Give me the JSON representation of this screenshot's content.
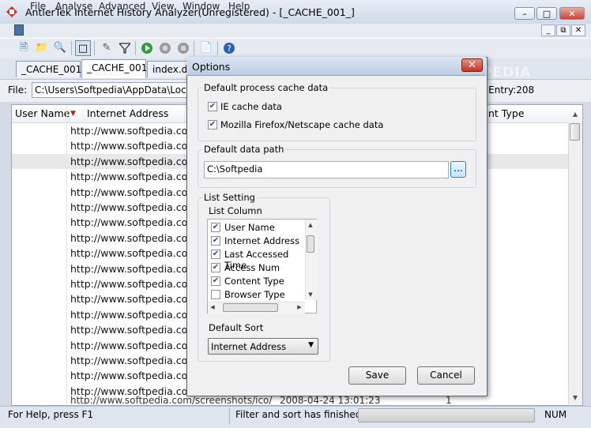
{
  "window": {
    "title": "AntlerTek Internet History Analyzer(Unregistered) - [_CACHE_001_]"
  },
  "menu": [
    "File",
    "Analyse",
    "Advanced",
    "View",
    "Window",
    "Help"
  ],
  "tabs": [
    "_CACHE_001_",
    "_CACHE_001_",
    "index.dat"
  ],
  "filebar": {
    "label": "File:",
    "path": "C:\\Users\\Softpedia\\AppData\\Local\\Temp",
    "entry": "l Entry:208"
  },
  "columns": {
    "user": "User Name",
    "url": "Internet Address",
    "type": "nt Type"
  },
  "rows": [
    "http://www.softpedia.com/",
    "http://www.softpedia.com/",
    "http://www.softpedia.com/",
    "http://www.softpedia.com/",
    "http://www.softpedia.com/",
    "http://www.softpedia.com/",
    "http://www.softpedia.com/",
    "http://www.softpedia.com/",
    "http://www.softpedia.com/",
    "http://www.softpedia.com/",
    "http://www.softpedia.com/",
    "http://www.softpedia.com/",
    "http://www.softpedia.com/",
    "http://www.softpedia.com/",
    "http://www.softpedia.com/",
    "http://www.softpedia.com/",
    "http://www.softpedia.com/",
    "http://www.softpedia.com/"
  ],
  "partial_row": {
    "url": "http://www.softpedia.com/screenshots/ico/",
    "date": "2008-04-24  13:01:23",
    "num": "1"
  },
  "status": {
    "help": "For Help, press F1",
    "message": "Filter and sort has finished!",
    "num": "NUM"
  },
  "watermark": "SOFTPEDIA",
  "dialog": {
    "title": "Options",
    "process_group": "Default process cache data",
    "ie": "IE cache data",
    "ff": "Mozilla Firefox/Netscape cache data",
    "path_group": "Default data path",
    "path_value": "C:\\Softpedia",
    "browse": "...",
    "list_group": "List Setting",
    "list_column": "List Column",
    "columns": [
      {
        "label": "User Name",
        "checked": true
      },
      {
        "label": "Internet Address",
        "checked": true
      },
      {
        "label": "Last Accessed Time",
        "checked": true
      },
      {
        "label": "Access Num",
        "checked": true
      },
      {
        "label": "Content Type",
        "checked": true
      },
      {
        "label": "Browser Type",
        "checked": false
      }
    ],
    "default_sort": "Default Sort",
    "sort_value": "Internet Address",
    "save": "Save",
    "cancel": "Cancel"
  }
}
